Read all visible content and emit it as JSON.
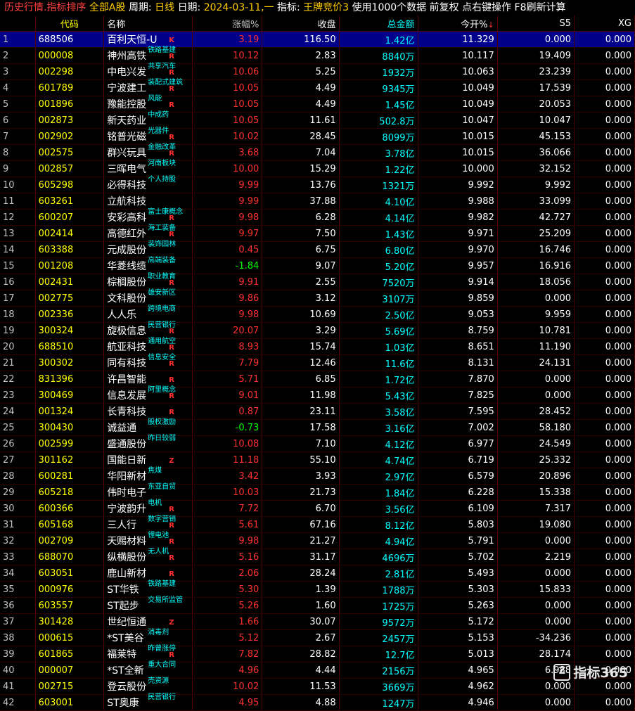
{
  "title": {
    "part1": "历史行情.指标排序",
    "part2": "全部A股",
    "part3": "周期:",
    "part4": "日线",
    "part5": "日期:",
    "part6": "2024-03-11,一",
    "part7": "指标:",
    "part8": "王牌竞价3",
    "part9": "使用1000个数据 前复权 点右键操作 F8刷新计算"
  },
  "columns": {
    "code": "代码",
    "name": "名称",
    "chg": "涨幅%",
    "close": "收盘",
    "amount": "总金额",
    "open": "今开%",
    "sort_icon": "↓",
    "s5": "S5",
    "xg": "XG"
  },
  "rows": [
    {
      "idx": "1",
      "code": "688506",
      "name": "百利天恒-U",
      "tag": "",
      "flag": "K",
      "chg": "3.19",
      "close": "116.50",
      "amount": "1.42亿",
      "open": "11.329",
      "s5": "0.000",
      "xg": "0.000",
      "dir": "up"
    },
    {
      "idx": "2",
      "code": "000008",
      "name": "神州高铁",
      "tag": "铁路基建",
      "flag": "R",
      "chg": "10.12",
      "close": "2.83",
      "amount": "8840万",
      "open": "10.117",
      "s5": "19.409",
      "xg": "0.000",
      "dir": "up"
    },
    {
      "idx": "3",
      "code": "002298",
      "name": "中电兴发",
      "tag": "共享汽车",
      "flag": "R",
      "chg": "10.06",
      "close": "5.25",
      "amount": "1932万",
      "open": "10.063",
      "s5": "23.239",
      "xg": "0.000",
      "dir": "up"
    },
    {
      "idx": "4",
      "code": "601789",
      "name": "宁波建工",
      "tag": "装配式建筑",
      "flag": "R",
      "chg": "10.05",
      "close": "4.49",
      "amount": "9345万",
      "open": "10.049",
      "s5": "17.539",
      "xg": "0.000",
      "dir": "up"
    },
    {
      "idx": "5",
      "code": "001896",
      "name": "豫能控股",
      "tag": "风能",
      "flag": "R",
      "chg": "10.05",
      "close": "4.49",
      "amount": "1.45亿",
      "open": "10.049",
      "s5": "20.053",
      "xg": "0.000",
      "dir": "up"
    },
    {
      "idx": "6",
      "code": "002873",
      "name": "新天药业",
      "tag": "中成药",
      "flag": "",
      "chg": "10.05",
      "close": "11.61",
      "amount": "502.8万",
      "open": "10.047",
      "s5": "10.047",
      "xg": "0.000",
      "dir": "up"
    },
    {
      "idx": "7",
      "code": "002902",
      "name": "铭普光磁",
      "tag": "光器件",
      "flag": "R",
      "chg": "10.02",
      "close": "28.45",
      "amount": "8099万",
      "open": "10.015",
      "s5": "45.153",
      "xg": "0.000",
      "dir": "up"
    },
    {
      "idx": "8",
      "code": "002575",
      "name": "群兴玩具",
      "tag": "金融改革",
      "flag": "R",
      "chg": "3.68",
      "close": "7.04",
      "amount": "3.78亿",
      "open": "10.015",
      "s5": "36.066",
      "xg": "0.000",
      "dir": "up"
    },
    {
      "idx": "9",
      "code": "002857",
      "name": "三晖电气",
      "tag": "河南板块",
      "flag": "",
      "chg": "10.00",
      "close": "15.29",
      "amount": "1.22亿",
      "open": "10.000",
      "s5": "32.152",
      "xg": "0.000",
      "dir": "up"
    },
    {
      "idx": "10",
      "code": "605298",
      "name": "必得科技",
      "tag": "个人持股",
      "flag": "",
      "chg": "9.99",
      "close": "13.76",
      "amount": "1321万",
      "open": "9.992",
      "s5": "9.992",
      "xg": "0.000",
      "dir": "up"
    },
    {
      "idx": "11",
      "code": "603261",
      "name": "立航科技",
      "tag": "",
      "flag": "",
      "chg": "9.99",
      "close": "37.88",
      "amount": "4.10亿",
      "open": "9.988",
      "s5": "33.099",
      "xg": "0.000",
      "dir": "up"
    },
    {
      "idx": "12",
      "code": "600207",
      "name": "安彩高科",
      "tag": "富士康概念",
      "flag": "R",
      "chg": "9.98",
      "close": "6.28",
      "amount": "4.14亿",
      "open": "9.982",
      "s5": "42.727",
      "xg": "0.000",
      "dir": "up"
    },
    {
      "idx": "13",
      "code": "002414",
      "name": "高德红外",
      "tag": "海工装备",
      "flag": "R",
      "chg": "9.97",
      "close": "7.50",
      "amount": "1.43亿",
      "open": "9.971",
      "s5": "25.209",
      "xg": "0.000",
      "dir": "up"
    },
    {
      "idx": "14",
      "code": "603388",
      "name": "元成股份",
      "tag": "装饰园林",
      "flag": "",
      "chg": "0.45",
      "close": "6.75",
      "amount": "6.80亿",
      "open": "9.970",
      "s5": "16.746",
      "xg": "0.000",
      "dir": "up"
    },
    {
      "idx": "15",
      "code": "001208",
      "name": "华菱线缆",
      "tag": "高端装备",
      "flag": "",
      "chg": "-1.84",
      "close": "9.07",
      "amount": "5.20亿",
      "open": "9.957",
      "s5": "16.916",
      "xg": "0.000",
      "dir": "down"
    },
    {
      "idx": "16",
      "code": "002431",
      "name": "棕榈股份",
      "tag": "职业教育",
      "flag": "R",
      "chg": "9.91",
      "close": "2.55",
      "amount": "7520万",
      "open": "9.914",
      "s5": "18.056",
      "xg": "0.000",
      "dir": "up"
    },
    {
      "idx": "17",
      "code": "002775",
      "name": "文科股份",
      "tag": "雄安新区",
      "flag": "",
      "chg": "9.86",
      "close": "3.12",
      "amount": "3107万",
      "open": "9.859",
      "s5": "0.000",
      "xg": "0.000",
      "dir": "up"
    },
    {
      "idx": "18",
      "code": "002336",
      "name": "人人乐",
      "tag": "跨境电商",
      "flag": "",
      "chg": "9.98",
      "close": "10.69",
      "amount": "2.50亿",
      "open": "9.053",
      "s5": "9.959",
      "xg": "0.000",
      "dir": "up"
    },
    {
      "idx": "19",
      "code": "300324",
      "name": "旋极信息",
      "tag": "民营银行",
      "flag": "R",
      "chg": "20.07",
      "close": "3.29",
      "amount": "5.69亿",
      "open": "8.759",
      "s5": "10.781",
      "xg": "0.000",
      "dir": "up"
    },
    {
      "idx": "20",
      "code": "688510",
      "name": "航亚科技",
      "tag": "通用航空",
      "flag": "R",
      "chg": "8.93",
      "close": "15.74",
      "amount": "1.03亿",
      "open": "8.651",
      "s5": "11.190",
      "xg": "0.000",
      "dir": "up"
    },
    {
      "idx": "21",
      "code": "300302",
      "name": "同有科技",
      "tag": "信息安全",
      "flag": "R",
      "chg": "7.79",
      "close": "12.46",
      "amount": "11.6亿",
      "open": "8.131",
      "s5": "24.131",
      "xg": "0.000",
      "dir": "up"
    },
    {
      "idx": "22",
      "code": "831396",
      "name": "许昌智能",
      "tag": "",
      "flag": "R",
      "chg": "5.71",
      "close": "6.85",
      "amount": "1.72亿",
      "open": "7.870",
      "s5": "0.000",
      "xg": "0.000",
      "dir": "up"
    },
    {
      "idx": "23",
      "code": "300469",
      "name": "信息发展",
      "tag": "阿里概念",
      "flag": "R",
      "chg": "9.01",
      "close": "11.98",
      "amount": "5.43亿",
      "open": "7.825",
      "s5": "0.000",
      "xg": "0.000",
      "dir": "up"
    },
    {
      "idx": "24",
      "code": "001324",
      "name": "长青科技",
      "tag": "",
      "flag": "R",
      "chg": "0.87",
      "close": "23.11",
      "amount": "3.58亿",
      "open": "7.595",
      "s5": "28.452",
      "xg": "0.000",
      "dir": "up"
    },
    {
      "idx": "25",
      "code": "300430",
      "name": "诚益通",
      "tag": "股权激励",
      "flag": "",
      "chg": "-0.73",
      "close": "17.58",
      "amount": "3.16亿",
      "open": "7.002",
      "s5": "58.180",
      "xg": "0.000",
      "dir": "down"
    },
    {
      "idx": "26",
      "code": "002599",
      "name": "盛通股份",
      "tag": "昨日较弱",
      "flag": "",
      "chg": "10.08",
      "close": "7.10",
      "amount": "4.12亿",
      "open": "6.977",
      "s5": "24.549",
      "xg": "0.000",
      "dir": "up"
    },
    {
      "idx": "27",
      "code": "301162",
      "name": "国能日新",
      "tag": "",
      "flag": "Z",
      "chg": "11.18",
      "close": "55.10",
      "amount": "4.74亿",
      "open": "6.719",
      "s5": "25.332",
      "xg": "0.000",
      "dir": "up"
    },
    {
      "idx": "28",
      "code": "600281",
      "name": "华阳新材",
      "tag": "焦煤",
      "flag": "",
      "chg": "3.42",
      "close": "3.93",
      "amount": "2.97亿",
      "open": "6.579",
      "s5": "20.896",
      "xg": "0.000",
      "dir": "up"
    },
    {
      "idx": "29",
      "code": "605218",
      "name": "伟时电子",
      "tag": "东亚自贸",
      "flag": "",
      "chg": "10.03",
      "close": "21.73",
      "amount": "1.84亿",
      "open": "6.228",
      "s5": "15.338",
      "xg": "0.000",
      "dir": "up"
    },
    {
      "idx": "30",
      "code": "600366",
      "name": "宁波韵升",
      "tag": "电机",
      "flag": "R",
      "chg": "7.72",
      "close": "6.70",
      "amount": "3.56亿",
      "open": "6.109",
      "s5": "7.317",
      "xg": "0.000",
      "dir": "up"
    },
    {
      "idx": "31",
      "code": "605168",
      "name": "三人行",
      "tag": "数字营销",
      "flag": "R",
      "chg": "5.61",
      "close": "67.16",
      "amount": "8.12亿",
      "open": "5.803",
      "s5": "19.080",
      "xg": "0.000",
      "dir": "up"
    },
    {
      "idx": "32",
      "code": "002709",
      "name": "天赐材料",
      "tag": "锂电池",
      "flag": "R",
      "chg": "9.98",
      "close": "21.27",
      "amount": "4.94亿",
      "open": "5.791",
      "s5": "0.000",
      "xg": "0.000",
      "dir": "up"
    },
    {
      "idx": "33",
      "code": "688070",
      "name": "纵横股份",
      "tag": "无人机",
      "flag": "R",
      "chg": "5.16",
      "close": "31.17",
      "amount": "4696万",
      "open": "5.702",
      "s5": "2.219",
      "xg": "0.000",
      "dir": "up"
    },
    {
      "idx": "34",
      "code": "603051",
      "name": "鹿山新材",
      "tag": "",
      "flag": "R",
      "chg": "2.06",
      "close": "28.24",
      "amount": "2.81亿",
      "open": "5.493",
      "s5": "0.000",
      "xg": "0.000",
      "dir": "up"
    },
    {
      "idx": "35",
      "code": "000976",
      "name": "ST华铁",
      "tag": "铁路基建",
      "flag": "",
      "chg": "5.30",
      "close": "1.39",
      "amount": "1788万",
      "open": "5.303",
      "s5": "15.833",
      "xg": "0.000",
      "dir": "up"
    },
    {
      "idx": "36",
      "code": "603557",
      "name": "ST起步",
      "tag": "交易所监管",
      "flag": "",
      "chg": "5.26",
      "close": "1.60",
      "amount": "1725万",
      "open": "5.263",
      "s5": "0.000",
      "xg": "0.000",
      "dir": "up"
    },
    {
      "idx": "37",
      "code": "301428",
      "name": "世纪恒通",
      "tag": "",
      "flag": "Z",
      "chg": "1.66",
      "close": "30.07",
      "amount": "9572万",
      "open": "5.172",
      "s5": "0.000",
      "xg": "0.000",
      "dir": "up"
    },
    {
      "idx": "38",
      "code": "000615",
      "name": "*ST美谷",
      "tag": "消毒剂",
      "flag": "",
      "chg": "5.12",
      "close": "2.67",
      "amount": "2457万",
      "open": "5.153",
      "s5": "-34.236",
      "xg": "0.000",
      "dir": "up"
    },
    {
      "idx": "39",
      "code": "601865",
      "name": "福莱特",
      "tag": "昨曾涨停",
      "flag": "R",
      "chg": "7.82",
      "close": "28.82",
      "amount": "12.7亿",
      "open": "5.013",
      "s5": "28.174",
      "xg": "0.000",
      "dir": "up"
    },
    {
      "idx": "40",
      "code": "000007",
      "name": "*ST全新",
      "tag": "重大合同",
      "flag": "",
      "chg": "4.96",
      "close": "4.44",
      "amount": "2156万",
      "open": "4.965",
      "s5": "6.988",
      "xg": "0.000",
      "dir": "up"
    },
    {
      "idx": "41",
      "code": "002715",
      "name": "登云股份",
      "tag": "壳资源",
      "flag": "",
      "chg": "10.02",
      "close": "11.53",
      "amount": "3669万",
      "open": "4.962",
      "s5": "0.000",
      "xg": "0.000",
      "dir": "up"
    },
    {
      "idx": "42",
      "code": "603001",
      "name": "ST奥康",
      "tag": "民营银行",
      "flag": "",
      "chg": "4.95",
      "close": "4.88",
      "amount": "1247万",
      "open": "4.946",
      "s5": "0.000",
      "xg": "0.000",
      "dir": "up"
    }
  ],
  "watermark": {
    "icon": "Z",
    "text": "指标365"
  }
}
